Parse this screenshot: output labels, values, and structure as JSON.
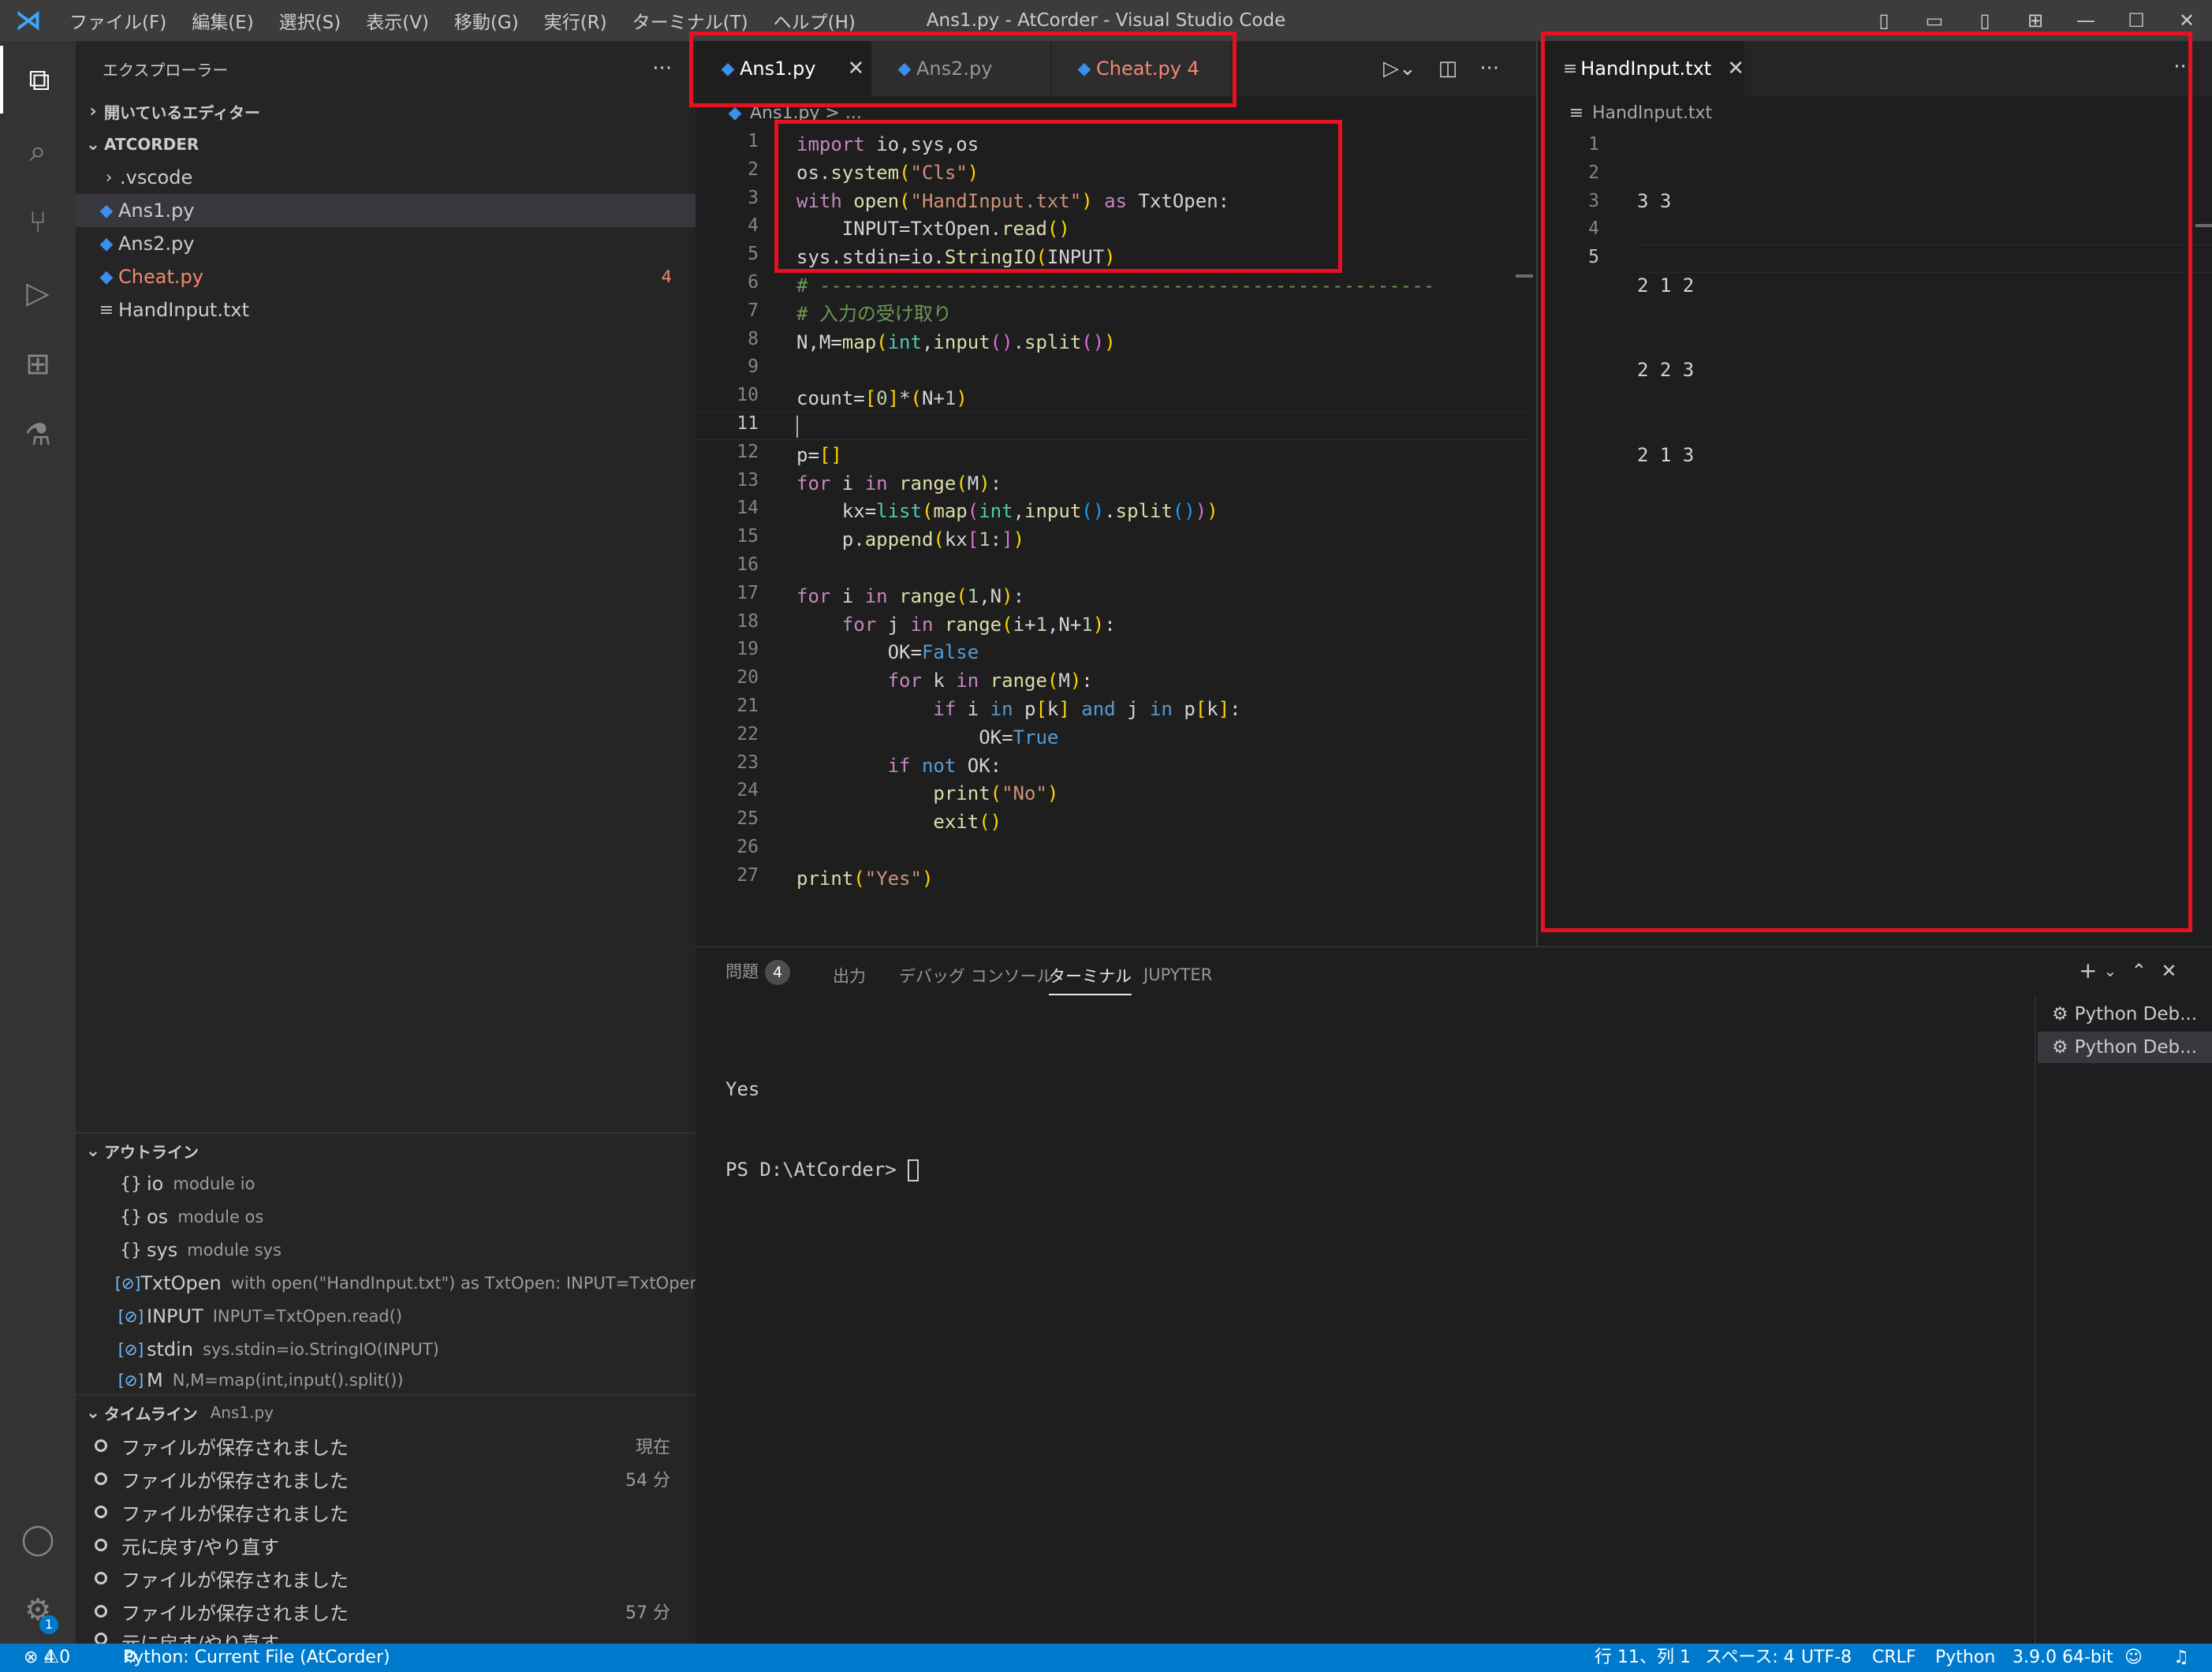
{
  "window": {
    "title": "Ans1.py - AtCorder - Visual Studio Code",
    "menus": [
      "ファイル(F)",
      "編集(E)",
      "選択(S)",
      "表示(V)",
      "移動(G)",
      "実行(R)",
      "ターミナル(T)",
      "ヘルプ(H)"
    ]
  },
  "explorer": {
    "title": "エクスプローラー",
    "open_editors": "開いているエディター",
    "folder": "ATCORDER",
    "items": [
      {
        "name": ".vscode"
      },
      {
        "name": "Ans1.py"
      },
      {
        "name": "Ans2.py"
      },
      {
        "name": "Cheat.py",
        "badge": "4"
      },
      {
        "name": "HandInput.txt"
      }
    ]
  },
  "outline": {
    "title": "アウトライン",
    "items": [
      {
        "name": "io",
        "detail": "module io"
      },
      {
        "name": "os",
        "detail": "module os"
      },
      {
        "name": "sys",
        "detail": "module sys"
      },
      {
        "name": "TxtOpen",
        "detail": "with open(\"HandInput.txt\") as TxtOpen: INPUT=TxtOpen.re..."
      },
      {
        "name": "INPUT",
        "detail": "INPUT=TxtOpen.read()"
      },
      {
        "name": "stdin",
        "detail": "sys.stdin=io.StringIO(INPUT)"
      },
      {
        "name": "M",
        "detail": "N,M=map(int,input().split())"
      }
    ]
  },
  "timeline": {
    "title": "タイムライン",
    "file": "Ans1.py",
    "items": [
      {
        "label": "ファイルが保存されました",
        "time": "現在"
      },
      {
        "label": "ファイルが保存されました",
        "time": "54 分"
      },
      {
        "label": "ファイルが保存されました",
        "time": ""
      },
      {
        "label": "元に戻す/やり直す",
        "time": ""
      },
      {
        "label": "ファイルが保存されました",
        "time": ""
      },
      {
        "label": "ファイルが保存されました",
        "time": "57 分"
      },
      {
        "label": "元に戻す/やり直す",
        "time": ""
      }
    ]
  },
  "tabs": [
    {
      "label": "Ans1.py",
      "close": "✕"
    },
    {
      "label": "Ans2.py"
    },
    {
      "label": "Cheat.py 4"
    }
  ],
  "breadcrumb": "Ans1.py > ...",
  "right_editor": {
    "tab": "HandInput.txt",
    "close": "✕",
    "breadcrumb": "HandInput.txt",
    "lines": [
      "3 3",
      "2 1 2",
      "2 2 3",
      "2 1 3",
      ""
    ]
  },
  "panel": {
    "tabs": [
      "問題",
      "出力",
      "デバッグ コンソール",
      "ターミナル",
      "JUPYTER"
    ],
    "problems_count": "4",
    "terminal_lines": [
      "Yes",
      "PS D:\\AtCorder> "
    ],
    "sessions": [
      "Python Deb...",
      "Python Deb..."
    ]
  },
  "statusbar": {
    "errors": "4",
    "warnings": "0",
    "run": "Python: Current File (AtCorder)",
    "position": "行 11、列 1",
    "spaces": "スペース: 4",
    "encoding": "UTF-8",
    "eol": "CRLF",
    "language": "Python",
    "interpreter": "3.9.0 64-bit"
  },
  "colors": {
    "accent": "#007acc",
    "highlight_box": "#e81123",
    "error": "#f48771"
  }
}
